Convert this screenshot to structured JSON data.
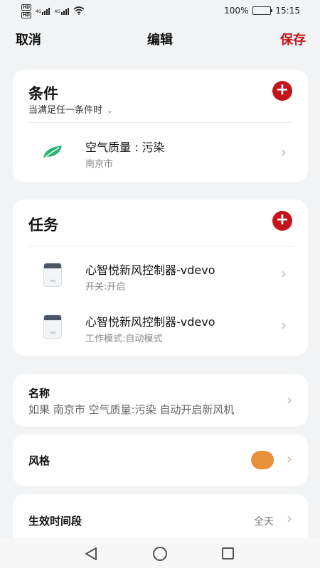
{
  "status_bar": {
    "hd1": "HD",
    "hd2": "HD",
    "net1": "4G",
    "net2": "4G",
    "battery": "100%",
    "time": "15:15"
  },
  "header": {
    "cancel_label": "取消",
    "title": "编辑",
    "save_label": "保存"
  },
  "conditions": {
    "title": "条件",
    "match_mode": "当满足任一条件时",
    "items": [
      {
        "main": "空气质量 : 污染",
        "sub": "南京市",
        "icon": "leaf-icon"
      }
    ]
  },
  "tasks": {
    "title": "任务",
    "items": [
      {
        "main": "心智悦新风控制器-vdevo",
        "sub": "开关:开启",
        "icon": "air-purifier-icon"
      },
      {
        "main": "心智悦新风控制器-vdevo",
        "sub": "工作模式:自动模式",
        "icon": "air-purifier-icon"
      }
    ]
  },
  "name_section": {
    "label": "名称",
    "value": "如果 南京市 空气质量:污染 自动开启新风机"
  },
  "style_section": {
    "label": "风格",
    "color": "#e8913a"
  },
  "time_section": {
    "label": "生效时间段",
    "value": "全天"
  },
  "colors": {
    "accent": "#c3161c",
    "leaf": "#2bb673"
  }
}
